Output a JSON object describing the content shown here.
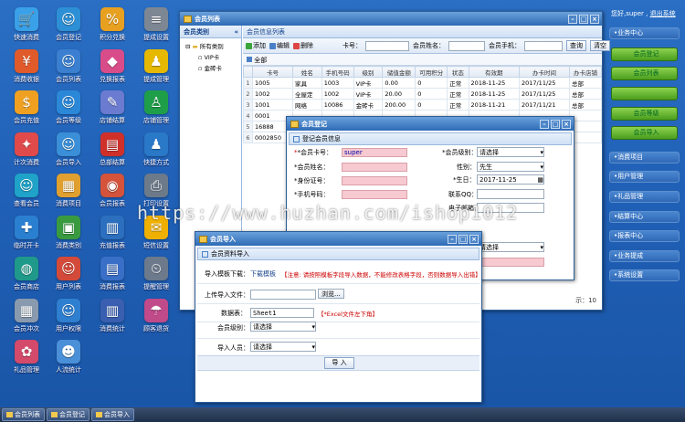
{
  "desktop_icons": [
    {
      "label": "快速消费",
      "icon": "cart-icon",
      "glyph": "🛒",
      "color": "#3aa0e8"
    },
    {
      "label": "会员登记",
      "icon": "user-add-icon",
      "glyph": "☺",
      "color": "#2d8fd5"
    },
    {
      "label": "积分兑换",
      "icon": "gift-icon",
      "glyph": "%",
      "color": "#e8a020"
    },
    {
      "label": "提成设置",
      "icon": "database-icon",
      "glyph": "≡",
      "color": "#7d8794"
    },
    {
      "label": "消费收银",
      "icon": "cashier-icon",
      "glyph": "¥",
      "color": "#e05a2a"
    },
    {
      "label": "会员列表",
      "icon": "member-list-icon",
      "glyph": "☺",
      "color": "#3a7fd0"
    },
    {
      "label": "兑换报表",
      "icon": "exchange-report-icon",
      "glyph": "◆",
      "color": "#d94c8a"
    },
    {
      "label": "提成管理",
      "icon": "commission-icon",
      "glyph": "♟",
      "color": "#e6b800"
    },
    {
      "label": "会员充值",
      "icon": "recharge-icon",
      "glyph": "$",
      "color": "#f0a020"
    },
    {
      "label": "会员等级",
      "icon": "level-icon",
      "glyph": "☺",
      "color": "#2b88d8"
    },
    {
      "label": "店铺结算",
      "icon": "settlement-icon",
      "glyph": "✎",
      "color": "#6b7bd0"
    },
    {
      "label": "店铺管理",
      "icon": "store-admin-icon",
      "glyph": "♙",
      "color": "#1f9e4a"
    },
    {
      "label": "计次消费",
      "icon": "count-consume-icon",
      "glyph": "✦",
      "color": "#e04a4a"
    },
    {
      "label": "会员导入",
      "icon": "import-icon",
      "glyph": "☺",
      "color": "#3a8fd8"
    },
    {
      "label": "总部结算",
      "icon": "hq-settlement-icon",
      "glyph": "▤",
      "color": "#d0302a"
    },
    {
      "label": "快捷方式",
      "icon": "shortcut-icon",
      "glyph": "♟",
      "color": "#2a78c8"
    },
    {
      "label": "查看会员",
      "icon": "view-member-icon",
      "glyph": "☺",
      "color": "#1fa3c9"
    },
    {
      "label": "消费项目",
      "icon": "consume-item-icon",
      "glyph": "▦",
      "color": "#e0a030"
    },
    {
      "label": "会员报表",
      "icon": "member-report-icon",
      "glyph": "◉",
      "color": "#d4533a"
    },
    {
      "label": "打印设置",
      "icon": "printer-icon",
      "glyph": "⎙",
      "color": "#6d7a8a"
    },
    {
      "label": "临时开卡",
      "icon": "temp-card-icon",
      "glyph": "✚",
      "color": "#2b7fd0"
    },
    {
      "label": "消费类别",
      "icon": "category-icon",
      "glyph": "▣",
      "color": "#3a9a40"
    },
    {
      "label": "充值报表",
      "icon": "recharge-report-icon",
      "glyph": "▥",
      "color": "#2c6fbf"
    },
    {
      "label": "短信设置",
      "icon": "sms-icon",
      "glyph": "✉",
      "color": "#f0b000"
    },
    {
      "label": "会员商店",
      "icon": "member-store-icon",
      "glyph": "◍",
      "color": "#1f9a8a"
    },
    {
      "label": "用户列表",
      "icon": "user-list-icon",
      "glyph": "☺",
      "color": "#d44a3a"
    },
    {
      "label": "消费报表",
      "icon": "consume-report-icon",
      "glyph": "▤",
      "color": "#3a6fc8"
    },
    {
      "label": "提醒管理",
      "icon": "reminder-icon",
      "glyph": "⏲",
      "color": "#6c7a8c"
    },
    {
      "label": "会员冲次",
      "icon": "member-times-icon",
      "glyph": "▦",
      "color": "#8a9aae"
    },
    {
      "label": "用户权限",
      "icon": "permission-icon",
      "glyph": "☺",
      "color": "#2f7fd0"
    },
    {
      "label": "消费统计",
      "icon": "statistics-icon",
      "glyph": "▥",
      "color": "#3a5fb0"
    },
    {
      "label": "顾客退货",
      "icon": "return-icon",
      "glyph": "☂",
      "color": "#c04a8a"
    },
    {
      "label": "礼品管理",
      "icon": "gift-manage-icon",
      "glyph": "✿",
      "color": "#d44a6a"
    },
    {
      "label": "人流统计",
      "icon": "traffic-icon",
      "glyph": "☻",
      "color": "#4a90d8"
    }
  ],
  "user_greeting": "您好,super ,",
  "logout_label": "退出系统",
  "side_menu": {
    "business_center": "•业务中心",
    "green_items": [
      "会员登记",
      "会员列表",
      "会员等级",
      "会员导入"
    ],
    "other_items": [
      "•消费项目",
      "•用户管理",
      "•礼品管理",
      "•结算中心",
      "•报表中心",
      "•业务提成",
      "•系统设置"
    ]
  },
  "member_list_window": {
    "title": "会员列表",
    "category_panel_title": "会员类别",
    "tree_root": "所有类别",
    "tree_children": [
      "VIP卡",
      "金砖卡"
    ],
    "info_panel_title": "会员信息列表",
    "toolbar": {
      "add": "添加",
      "edit": "编辑",
      "delete": "删除",
      "card_no_label": "卡号：",
      "name_label": "会员姓名：",
      "phone_label": "会员手机：",
      "search": "查询",
      "clear": "清空"
    },
    "tab_all": "全部",
    "columns": [
      "卡号",
      "姓名",
      "手机号码",
      "级别",
      "储值金额",
      "可用积分",
      "状态",
      "有效期",
      "办卡时间",
      "办卡店铺"
    ],
    "rows": [
      [
        "1005",
        "家具",
        "1003",
        "VIP卡",
        "0.00",
        "0",
        "正常",
        "2018-11-25",
        "2017/11/25",
        "总部"
      ],
      [
        "1002",
        "全屋定",
        "1002",
        "VIP卡",
        "20.00",
        "0",
        "正常",
        "2018-11-25",
        "2017/11/25",
        "总部"
      ],
      [
        "1001",
        "网络",
        "10086",
        "金砖卡",
        "200.00",
        "0",
        "正常",
        "2018-11-21",
        "2017/11/21",
        "总部"
      ],
      [
        "0001",
        "",
        "",
        "",
        "",
        "",
        "",
        "",
        "",
        ""
      ],
      [
        "16888",
        "",
        "",
        "",
        "",
        "",
        "",
        "",
        "",
        ""
      ],
      [
        "0002850",
        "",
        "",
        "",
        "",
        "",
        "",
        "",
        "",
        ""
      ]
    ],
    "pager_text": "示：10"
  },
  "register_window": {
    "title": "会员登记",
    "section": "登记会员信息",
    "card_no_label": "*会员卡号：",
    "card_no_value": "super",
    "level_label": "*会员级别：",
    "level_value": "请选择",
    "name_label": "*会员姓名：",
    "gender_label": "性别：",
    "gender_value": "先生",
    "id_label": "*身份证号：",
    "birthday_label": "*生日：",
    "birthday_value": "2017-11-25",
    "phone_label": "*手机号码：",
    "contact_label": "联系QQ：",
    "email_label": "电子邮箱：",
    "extra_select_value": "请选择"
  },
  "import_window": {
    "title": "会员导入",
    "section": "会员资料导入",
    "template_label": "导入模板下载：",
    "template_link": "下载模板",
    "template_note": "【注意: 请按照模板字段导入数据，不能修改表格字段，否则数据导入出错】",
    "file_label": "上传导入文件：",
    "browse": "浏览...",
    "sheet_label": "数据表：",
    "sheet_value": "Sheet1",
    "sheet_note": "【*Excel文件左下角】",
    "level_label": "会员级别：",
    "level_value": "请选择",
    "staff_label": "导入人员：",
    "staff_value": "请选择",
    "import_button": "导  入"
  },
  "taskbar": [
    "会员列表",
    "会员登记",
    "会员导入"
  ],
  "watermark": "https://www.huzhan.com/ishop1012"
}
